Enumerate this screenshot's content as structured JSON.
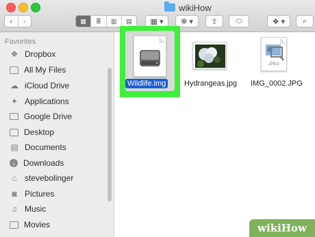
{
  "window": {
    "title": "wikiHow"
  },
  "toolbar": {
    "back_icon": "‹",
    "forward_icon": "›",
    "view_icons": [
      "▦",
      "≣",
      "▥",
      "▤"
    ],
    "arrange_icon": "▦ ▾",
    "action_icon": "✻ ▾",
    "share_icon": "⇪",
    "tag_icon": "⬭",
    "dropbox_icon": "❖ ▾",
    "search_icon": "⌕"
  },
  "sidebar": {
    "section_title": "Favorites",
    "items": [
      {
        "label": "Dropbox",
        "icon": "dropbox-icon"
      },
      {
        "label": "All My Files",
        "icon": "all-files-icon"
      },
      {
        "label": "iCloud Drive",
        "icon": "cloud-icon"
      },
      {
        "label": "Applications",
        "icon": "applications-icon"
      },
      {
        "label": "Google Drive",
        "icon": "folder-icon"
      },
      {
        "label": "Desktop",
        "icon": "desktop-icon"
      },
      {
        "label": "Documents",
        "icon": "documents-icon"
      },
      {
        "label": "Downloads",
        "icon": "downloads-icon"
      },
      {
        "label": "stevebolinger",
        "icon": "home-icon"
      },
      {
        "label": "Pictures",
        "icon": "pictures-icon"
      },
      {
        "label": "Music",
        "icon": "music-icon"
      },
      {
        "label": "Movies",
        "icon": "movies-icon"
      }
    ]
  },
  "files": [
    {
      "name": "Wildlife.img",
      "selected": true,
      "kind": "disk-image"
    },
    {
      "name": "Hydrangeas.jpg",
      "selected": false,
      "kind": "photo"
    },
    {
      "name": "IMG_0002.JPG",
      "selected": false,
      "kind": "jpeg",
      "badge": "JPEG"
    }
  ],
  "watermark": {
    "text": "wikiHow"
  },
  "colors": {
    "highlight": "#3ef03a",
    "selection": "#1c5fd1"
  }
}
